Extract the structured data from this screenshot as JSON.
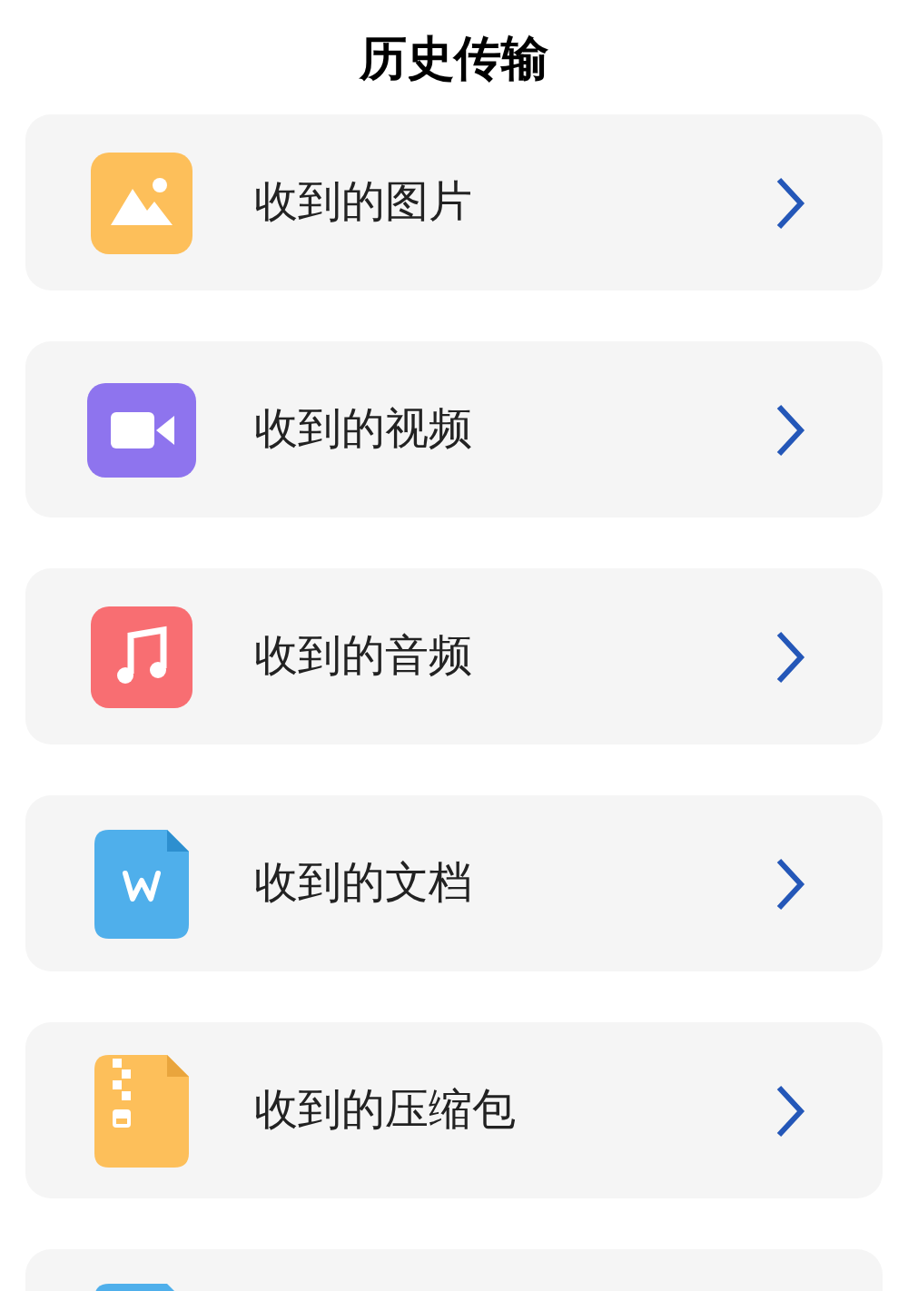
{
  "title": "历史传输",
  "items": [
    {
      "kind": "image",
      "label": "收到的图片"
    },
    {
      "kind": "video",
      "label": "收到的视频"
    },
    {
      "kind": "audio",
      "label": "收到的音频"
    },
    {
      "kind": "document",
      "label": "收到的文档"
    },
    {
      "kind": "archive",
      "label": "收到的压缩包"
    },
    {
      "kind": "other"
    }
  ]
}
